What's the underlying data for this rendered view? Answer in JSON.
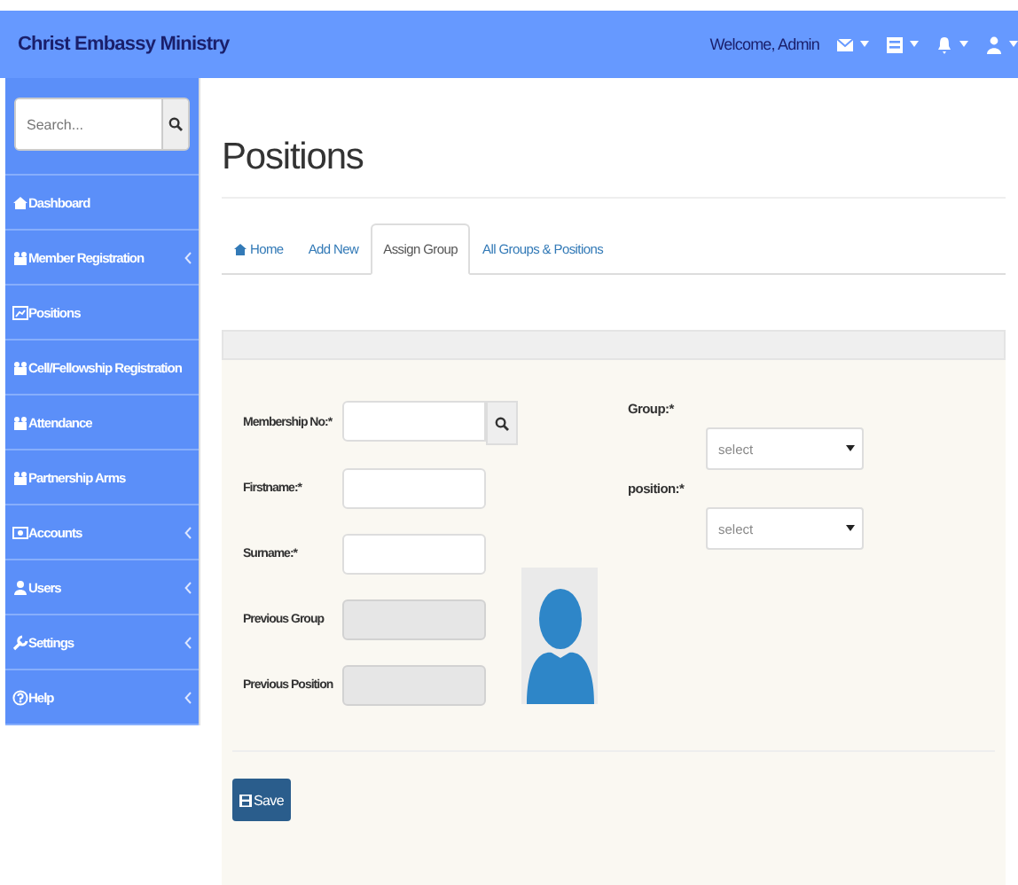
{
  "navbar": {
    "brand": "Christ Embassy Ministry",
    "welcome": "Welcome, Admin"
  },
  "sidebar": {
    "search": {
      "placeholder": "Search..."
    },
    "items": [
      {
        "label": "Dashboard",
        "submenu": false,
        "selected": false
      },
      {
        "label": "Member Registration",
        "submenu": true,
        "selected": false
      },
      {
        "label": "Positions",
        "submenu": false,
        "selected": false
      },
      {
        "label": "Cell/Fellowship Registration",
        "submenu": false,
        "selected": false
      },
      {
        "label": "Attendance",
        "submenu": false,
        "selected": false
      },
      {
        "label": "Partnership Arms",
        "submenu": false,
        "selected": false
      },
      {
        "label": "Accounts",
        "submenu": true,
        "selected": false
      },
      {
        "label": "Users",
        "submenu": true,
        "selected": false
      },
      {
        "label": "Settings",
        "submenu": true,
        "selected": false
      },
      {
        "label": "Help",
        "submenu": true,
        "selected": false
      }
    ]
  },
  "page": {
    "title": "Positions"
  },
  "tabs": [
    {
      "label": "Home",
      "selected": false
    },
    {
      "label": "Add New",
      "selected": false
    },
    {
      "label": "Assign Group",
      "selected": true
    },
    {
      "label": "All Groups & Positions",
      "selected": false
    }
  ],
  "form": {
    "left": [
      {
        "label": "Membership No:*",
        "kind": "search",
        "disabled": false
      },
      {
        "label": "Firstname:*",
        "kind": "text",
        "disabled": false
      },
      {
        "label": "Surname:*",
        "kind": "text",
        "disabled": false
      },
      {
        "label": "Previous Group",
        "kind": "text",
        "disabled": true
      },
      {
        "label": "Previous Position",
        "kind": "text",
        "disabled": true
      }
    ],
    "right": [
      {
        "label": "Group:*",
        "value": "select"
      },
      {
        "label": "position:*",
        "value": "select"
      }
    ],
    "save": "Save"
  }
}
